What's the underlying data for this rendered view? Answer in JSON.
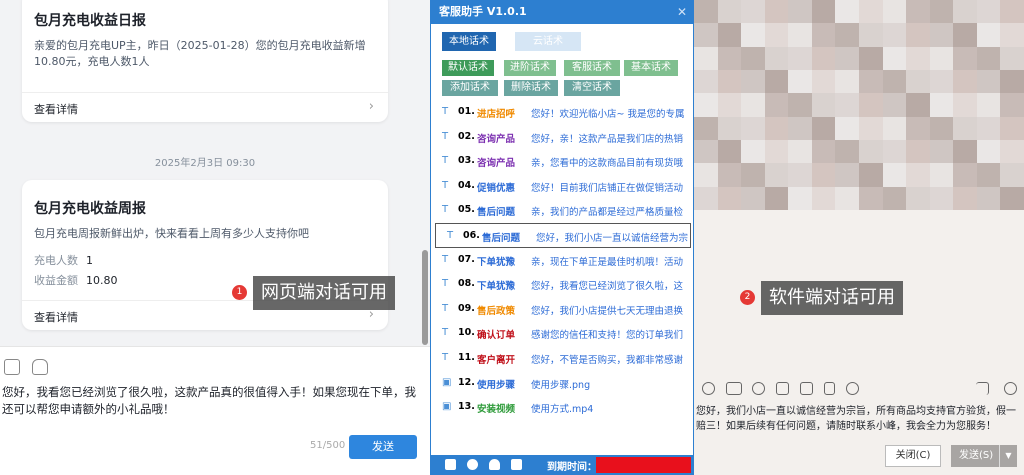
{
  "left": {
    "card1": {
      "title": "包月充电收益日报",
      "body": "亲爱的包月充电UP主，昨日（2025-01-28）您的包月充电收益新增10.80元，充电人数1人",
      "link": "查看详情"
    },
    "timestamp": "2025年2月3日 09:30",
    "card2": {
      "title": "包月充电收益周报",
      "body": "包月充电周报新鲜出炉，快来看看上周有多少人支持你吧",
      "rows": [
        {
          "k": "充电人数",
          "v": "1"
        },
        {
          "k": "收益金额",
          "v": "10.80"
        }
      ],
      "link": "查看详情"
    },
    "composer_text": "您好，我看您已经浏览了很久啦，这款产品真的很值得入手！如果您现在下单，我还可以帮您申请额外的小礼品哦！",
    "counter": "51/500",
    "send": "发送",
    "callout_num": "1",
    "callout": "网页端对话可用"
  },
  "mid": {
    "title": "客服助手 V1.0.1",
    "close": "✕",
    "tab_local": "本地话术",
    "tab_cloud": "云话术",
    "cats_row1": [
      "默认话术",
      "进阶话术",
      "客服话术",
      "基本话术"
    ],
    "cats_row2": [
      "添加话术",
      "删除话术",
      "清空话术"
    ],
    "items": [
      {
        "no": "01.",
        "name": "进店招呼",
        "color": "#f08a00",
        "text": "您好！欢迎光临小店~ 我是您的专属"
      },
      {
        "no": "02.",
        "name": "咨询产品",
        "color": "#7b2fb0",
        "text": "您好，亲！这款产品是我们店的热销"
      },
      {
        "no": "03.",
        "name": "咨询产品",
        "color": "#7b2fb0",
        "text": "亲，您看中的这款商品目前有现货哦"
      },
      {
        "no": "04.",
        "name": "促销优惠",
        "color": "#2c6bd6",
        "text": "您好！目前我们店铺正在做促销活动"
      },
      {
        "no": "05.",
        "name": "售后问题",
        "color": "#2c6bd6",
        "text": "亲，我们的产品都是经过严格质量检"
      },
      {
        "no": "06.",
        "name": "售后问题",
        "color": "#2c6bd6",
        "text": "您好，我们小店一直以诚信经营为宗"
      },
      {
        "no": "07.",
        "name": "下单犹豫",
        "color": "#2c6bd6",
        "text": "亲，现在下单正是最佳时机哦！活动"
      },
      {
        "no": "08.",
        "name": "下单犹豫",
        "color": "#2c6bd6",
        "text": "您好，我看您已经浏览了很久啦，这"
      },
      {
        "no": "09.",
        "name": "售后政策",
        "color": "#f08a00",
        "text": "您好，我们小店提供七天无理由退换"
      },
      {
        "no": "10.",
        "name": "确认订单",
        "color": "#c0101a",
        "text": "感谢您的信任和支持！您的订单我们"
      },
      {
        "no": "11.",
        "name": "客户离开",
        "color": "#c0101a",
        "text": "您好，不管是否购买，我都非常感谢"
      },
      {
        "no": "12.",
        "name": "使用步骤",
        "color": "#2c6bd6",
        "text": "使用步骤.png"
      },
      {
        "no": "13.",
        "name": "安装视频",
        "color": "#2e9b3a",
        "text": "使用方式.mp4"
      }
    ],
    "footer_label": "到期时间："
  },
  "right": {
    "callout_num": "2",
    "callout": "软件端对话可用",
    "text": "您好，我们小店一直以诚信经营为宗旨，所有商品均支持官方验货，假一赔三！如果后续有任何问题，请随时联系小峰，我会全力为您服务！",
    "close": "关闭(C)",
    "send": "发送(S)"
  }
}
